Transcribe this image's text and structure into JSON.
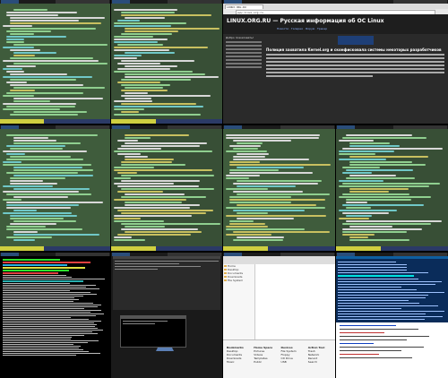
{
  "layout": "4x3 tiled screenshot collage",
  "colors": {
    "terminal_bg": "#3f5c3c",
    "statusbar_bg": "#1b1b1b",
    "modeline_bg": "#2b3a66",
    "browser_site_bg": "#2a2a2a",
    "htop_bg": "#000000",
    "mutt_list_bg": "#0a2c5a"
  },
  "browser": {
    "tab_title": "LINUX.ORG.RU",
    "url": "www.linux.org.ru",
    "site_title": "LINUX.ORG.RU — Русская информация об ОС Linux",
    "nav": "Новости · Галерея · Форум · Трекер",
    "sidebar_title": "Добро пожаловать!",
    "article_title": "Полиция захватила Kernel.org и сконфисковала системы некоторых разработчиков"
  },
  "file_manager": {
    "sidebar_items": [
      "Home",
      "Desktop",
      "Documents",
      "Downloads",
      "File System"
    ],
    "panel_columns": [
      {
        "header": "Bookmarks",
        "items": [
          "Desktop",
          "Documents",
          "Downloads",
          "Music"
        ]
      },
      {
        "header": "Home Space",
        "items": [
          "Pictures",
          "Videos",
          "Templates",
          "Public"
        ]
      },
      {
        "header": "Devices",
        "items": [
          "File System",
          "Floppy",
          "CD Drive",
          "USB"
        ]
      },
      {
        "header": "Action Tool",
        "items": [
          "Trash",
          "Network",
          "Recent",
          "Search"
        ]
      }
    ]
  }
}
